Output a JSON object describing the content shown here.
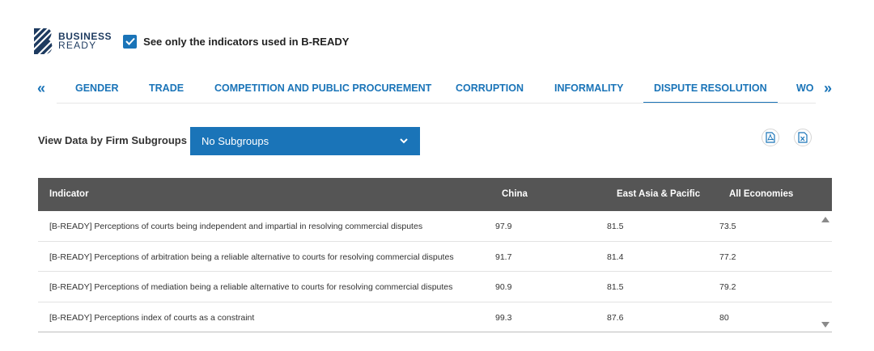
{
  "header": {
    "logo_line1": "BUSINESS",
    "logo_line2": "READY",
    "checkbox_label": "See only the indicators used in B-READY",
    "checkbox_checked": true
  },
  "tabs": [
    {
      "label": "GENDER",
      "active": false
    },
    {
      "label": "TRADE",
      "active": false
    },
    {
      "label": "COMPETITION AND PUBLIC PROCUREMENT",
      "active": false
    },
    {
      "label": "CORRUPTION",
      "active": false
    },
    {
      "label": "INFORMALITY",
      "active": false
    },
    {
      "label": "DISPUTE RESOLUTION",
      "active": true
    },
    {
      "label": "WO",
      "active": false
    }
  ],
  "tab_arrows": {
    "left": "«",
    "right": "»"
  },
  "subgroups": {
    "label": "View Data by Firm Subgroups",
    "selected": "No Subgroups"
  },
  "table": {
    "columns": [
      "Indicator",
      "China",
      "East Asia & Pacific",
      "All Economies"
    ],
    "rows": [
      [
        "[B-READY] Perceptions of courts being independent and impartial in resolving commercial disputes",
        "97.9",
        "81.5",
        "73.5"
      ],
      [
        "[B-READY] Perceptions of arbitration being a reliable alternative to courts for resolving commercial disputes",
        "91.7",
        "81.4",
        "77.2"
      ],
      [
        "[B-READY] Perceptions of mediation being a reliable alternative to courts for resolving commercial disputes",
        "90.9",
        "81.5",
        "79.2"
      ],
      [
        "[B-READY] Perceptions index of courts as a constraint",
        "99.3",
        "87.6",
        "80"
      ]
    ]
  },
  "colors": {
    "accent": "#1a74b8",
    "header_bg": "#555555",
    "logo": "#1d3a5f"
  }
}
